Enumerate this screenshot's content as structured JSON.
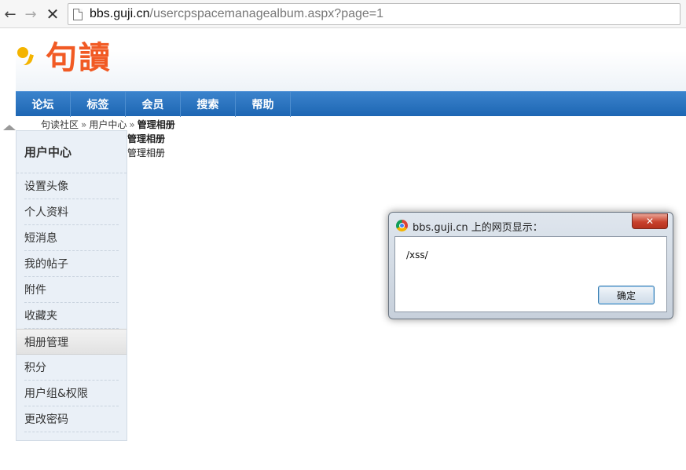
{
  "browser": {
    "url_host": "bbs.guji.cn",
    "url_path": "/usercpspacemanagealbum.aspx?page=1"
  },
  "site": {
    "logo_text": "句讀"
  },
  "nav": {
    "items": [
      {
        "label": "论坛"
      },
      {
        "label": "标签"
      },
      {
        "label": "会员"
      },
      {
        "label": "搜索"
      },
      {
        "label": "帮助"
      }
    ]
  },
  "breadcrumb": {
    "home": "句读社区",
    "sep": "»",
    "usercenter": "用户中心",
    "current": "管理相册"
  },
  "page": {
    "title": "管理相册",
    "subtitle": "管理相册"
  },
  "sidebar": {
    "heading": "用户中心",
    "items": [
      {
        "label": "设置头像"
      },
      {
        "label": "个人资料"
      },
      {
        "label": "短消息"
      },
      {
        "label": "我的帖子"
      },
      {
        "label": "附件"
      },
      {
        "label": "收藏夹"
      },
      {
        "label": "相册管理"
      },
      {
        "label": "积分"
      },
      {
        "label": "用户组&权限"
      },
      {
        "label": "更改密码"
      }
    ]
  },
  "dialog": {
    "title": "bbs.guji.cn 上的网页显示：",
    "close_label": "✕",
    "message": "/xss/",
    "ok_label": "确定"
  }
}
